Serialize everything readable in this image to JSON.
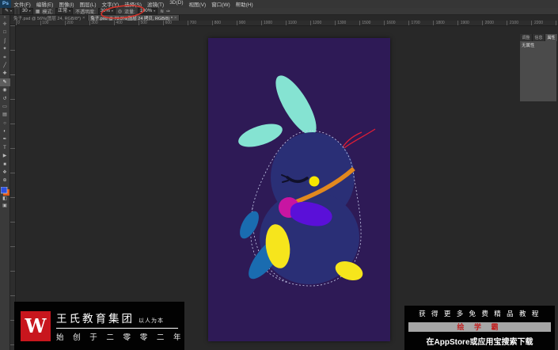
{
  "app": {
    "logo": "Ps",
    "menus": [
      "文件(F)",
      "编辑(E)",
      "图像(I)",
      "图层(L)",
      "文字(Y)",
      "选择(S)",
      "滤镜(T)",
      "3D(D)",
      "视图(V)",
      "窗口(W)",
      "帮助(H)"
    ]
  },
  "options": {
    "tool_glyph": "✎",
    "brush_size": "30",
    "mode_label": "模式:",
    "mode_value": "正常",
    "opacity_label": "不透明度:",
    "opacity_value": "30%",
    "flow_label": "流量:",
    "flow_value": "100%",
    "pressure_glyph": "◎",
    "airbrush_glyph": "≋",
    "size_pressure_glyph": "✑",
    "annotation_color": "#d5342b"
  },
  "document_tabs": [
    {
      "title": "兔子.psd @ 56%(图层 24, RGB/8*)",
      "close": "×"
    },
    {
      "title": "兔子.psd @ 73.3%(图层 24 拷贝, RGB/8) *",
      "close": "×"
    }
  ],
  "toolbar": {
    "collapse": "»",
    "tools": [
      {
        "name": "move",
        "glyph": "✛"
      },
      {
        "name": "marquee",
        "glyph": "□"
      },
      {
        "name": "lasso",
        "glyph": "ʃ"
      },
      {
        "name": "quick-select",
        "glyph": "✦"
      },
      {
        "name": "crop",
        "glyph": "⌗"
      },
      {
        "name": "eyedropper",
        "glyph": "╱"
      },
      {
        "name": "healing-brush",
        "glyph": "✚"
      },
      {
        "name": "brush",
        "glyph": "✎",
        "active": true
      },
      {
        "name": "clone-stamp",
        "glyph": "◉"
      },
      {
        "name": "history-brush",
        "glyph": "↺"
      },
      {
        "name": "eraser",
        "glyph": "▭"
      },
      {
        "name": "gradient",
        "glyph": "▤"
      },
      {
        "name": "blur",
        "glyph": "○"
      },
      {
        "name": "dodge",
        "glyph": "◐"
      },
      {
        "name": "pen",
        "glyph": "✒"
      },
      {
        "name": "type",
        "glyph": "T"
      },
      {
        "name": "path-select",
        "glyph": "▶"
      },
      {
        "name": "shape",
        "glyph": "■"
      },
      {
        "name": "hand",
        "glyph": "❖"
      },
      {
        "name": "zoom",
        "glyph": "⊕"
      }
    ],
    "foreground_color": "#2e52e0",
    "background_color": "#e05a1a",
    "mask_glyph": "◧",
    "screen_glyph": "▣"
  },
  "ruler_numbers": [
    "0",
    "100",
    "200",
    "300",
    "400",
    "500",
    "600",
    "700",
    "800",
    "900",
    "1000",
    "1100",
    "1200",
    "1300",
    "1500",
    "1600",
    "1700",
    "1800",
    "1900",
    "2000",
    "2100",
    "2200"
  ],
  "right_panel": {
    "tabs": [
      {
        "label": "调整"
      },
      {
        "label": "信息"
      },
      {
        "label": "属性",
        "active": true
      }
    ],
    "content": "无属性"
  },
  "rabbit": {
    "canvas_bg": "#2e1a56",
    "body": "#2a2f76",
    "ear": "#85e3d2",
    "eye_lash": "#10102a",
    "eye_dot": "#f6e500",
    "collar": "#e2881e",
    "string": "#e11d35",
    "ball": "#c815a2",
    "ball_dot": "#1a0a25",
    "paw_blob": "#5a10d8",
    "belly": "#f6e51c",
    "foot_blue": "#1a6cb0",
    "foot_yellow": "#f6e51c",
    "selection": "#ccd2f0"
  },
  "watermark_left": {
    "logo_letter": "W",
    "logo_color": "#c8161d",
    "title": "王氏教育集团",
    "tagline": "以人为本",
    "line2": "始 创 于 二 零 零 二 年"
  },
  "watermark_right": {
    "line1": "获 得 更 多 免 费 精 品 教 程",
    "badge": "绘 学 霸",
    "badge_bg": "#a6a6a6",
    "badge_color": "#c01f1f",
    "line2": "在AppStore或应用宝搜索下载"
  }
}
